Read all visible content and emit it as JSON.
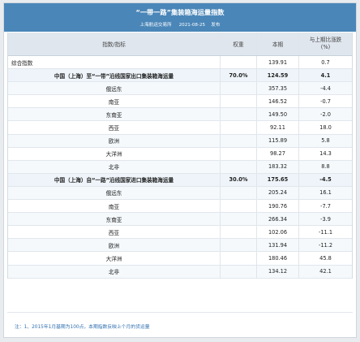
{
  "banner": {
    "title": "“一带一路”集装箱海运量指数",
    "publisher": "上海航运交易所",
    "date": "2021-08-25",
    "action": "发布"
  },
  "table": {
    "headers": {
      "name": "指数/指标",
      "weight": "权重",
      "current": "本期",
      "change_line1": "与上期比涨跌",
      "change_line2": "(%)"
    },
    "rows": [
      {
        "name": "综合指数",
        "weight": "",
        "current": "139.91",
        "change": "0.7",
        "kind": "summary"
      },
      {
        "name": "中国（上海）至“一带”沿线国家出口集装箱海运量",
        "weight": "70.0%",
        "current": "124.59",
        "change": "4.1",
        "kind": "group"
      },
      {
        "name": "俄远东",
        "weight": "",
        "current": "357.35",
        "change": "-4.4",
        "kind": "item"
      },
      {
        "name": "南亚",
        "weight": "",
        "current": "146.52",
        "change": "-0.7",
        "kind": "item"
      },
      {
        "name": "东南亚",
        "weight": "",
        "current": "149.50",
        "change": "-2.0",
        "kind": "item"
      },
      {
        "name": "西亚",
        "weight": "",
        "current": "92.11",
        "change": "18.0",
        "kind": "item"
      },
      {
        "name": "欧洲",
        "weight": "",
        "current": "115.89",
        "change": "5.8",
        "kind": "item"
      },
      {
        "name": "大洋洲",
        "weight": "",
        "current": "98.27",
        "change": "14.3",
        "kind": "item"
      },
      {
        "name": "北非",
        "weight": "",
        "current": "183.32",
        "change": "8.8",
        "kind": "item"
      },
      {
        "name": "中国（上海）自“一路”沿线国家进口集装箱海运量",
        "weight": "30.0%",
        "current": "175.65",
        "change": "-4.5",
        "kind": "group"
      },
      {
        "name": "俄远东",
        "weight": "",
        "current": "205.24",
        "change": "16.1",
        "kind": "item"
      },
      {
        "name": "南亚",
        "weight": "",
        "current": "190.76",
        "change": "-7.7",
        "kind": "item"
      },
      {
        "name": "东南亚",
        "weight": "",
        "current": "266.34",
        "change": "-3.9",
        "kind": "item"
      },
      {
        "name": "西亚",
        "weight": "",
        "current": "102.06",
        "change": "-11.1",
        "kind": "item"
      },
      {
        "name": "欧洲",
        "weight": "",
        "current": "131.94",
        "change": "-11.2",
        "kind": "item"
      },
      {
        "name": "大洋洲",
        "weight": "",
        "current": "180.46",
        "change": "45.8",
        "kind": "item"
      },
      {
        "name": "北非",
        "weight": "",
        "current": "134.12",
        "change": "42.1",
        "kind": "item"
      }
    ]
  },
  "footnote": "注：1、2015年1月基期为100点，本期指数反映上个月的货运量"
}
